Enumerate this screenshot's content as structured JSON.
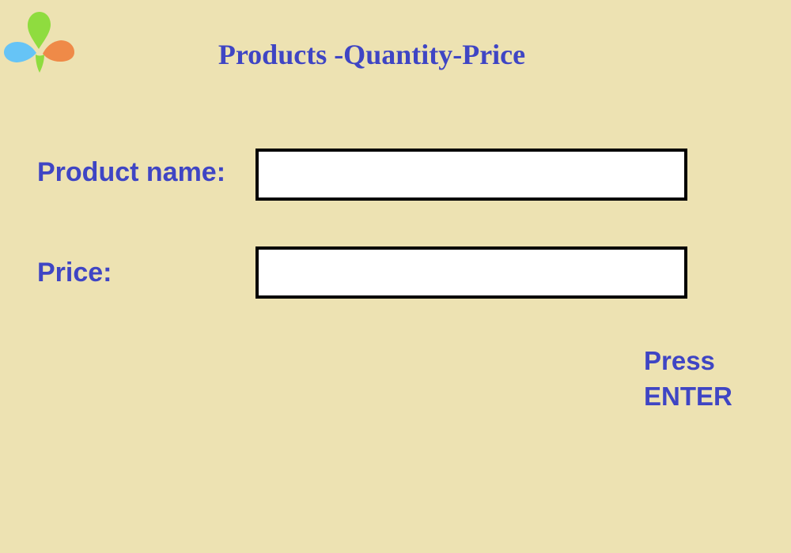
{
  "header": {
    "title": "Products -Quantity-Price",
    "logo_icon": "flower-petals-icon"
  },
  "form": {
    "product_name": {
      "label": "Product name:",
      "value": "",
      "placeholder": ""
    },
    "price": {
      "label": "Price:",
      "value": "",
      "placeholder": ""
    }
  },
  "hint": {
    "line1": "Press",
    "line2": "ENTER"
  },
  "colors": {
    "background": "#ede2b2",
    "text_accent": "#3f45c4",
    "petal_green": "#8fdc3f",
    "petal_blue": "#66c4f6",
    "petal_orange": "#ef8a48"
  }
}
